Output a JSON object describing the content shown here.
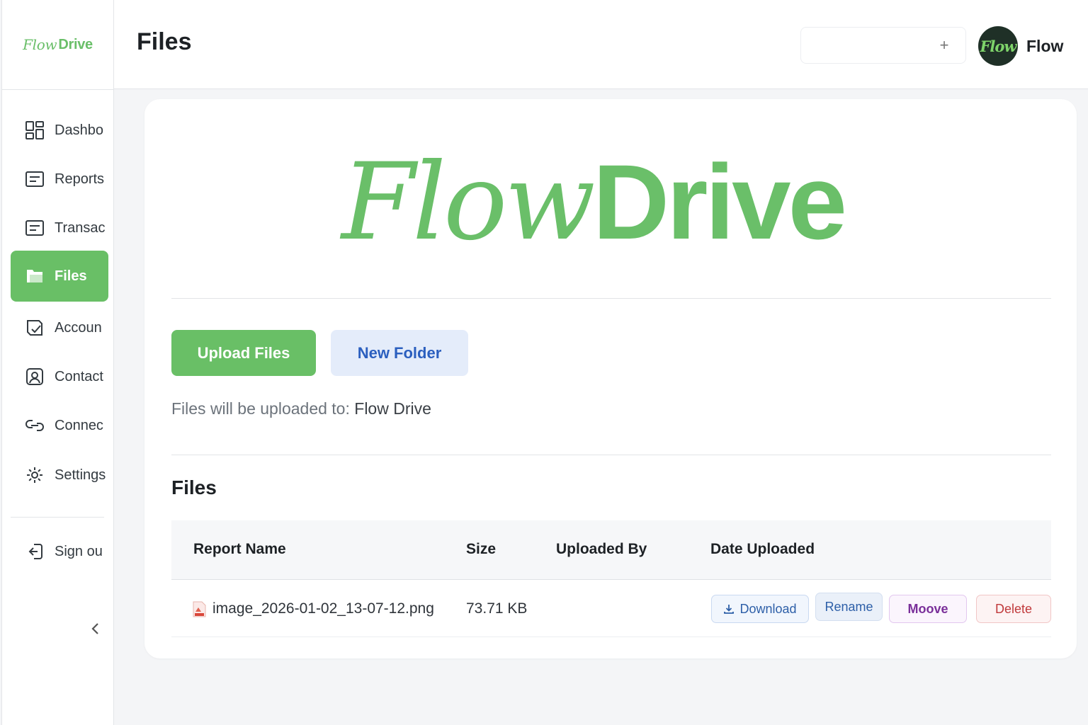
{
  "app": {
    "logo_flow": "Flow",
    "logo_drive": "Drive",
    "brand_color": "#6abf69"
  },
  "sidebar": {
    "items": [
      {
        "label": "Dashbo",
        "icon": "dashboard-icon",
        "active": false
      },
      {
        "label": "Reports",
        "icon": "reports-icon",
        "active": false
      },
      {
        "label": "Transac",
        "icon": "transactions-icon",
        "active": false
      },
      {
        "label": "Files",
        "icon": "folder-icon",
        "active": true
      },
      {
        "label": "Accoun",
        "icon": "accounts-icon",
        "active": false
      },
      {
        "label": "Contact",
        "icon": "contact-icon",
        "active": false
      },
      {
        "label": "Connec",
        "icon": "connections-icon",
        "active": false
      },
      {
        "label": "Settings",
        "icon": "gear-icon",
        "active": false
      },
      {
        "label": "Sign ou",
        "icon": "sign-out-icon",
        "active": false
      }
    ],
    "collapse_icon": "chevron-left-icon"
  },
  "header": {
    "title": "Files",
    "add_icon": "plus-icon",
    "avatar_text": "Flow",
    "user_name": "Flow"
  },
  "main": {
    "brand_flow": "Flow",
    "brand_drive": "Drive",
    "upload_button": "Upload Files",
    "new_folder_button": "New Folder",
    "upload_dest_label": "Files will be uploaded to: ",
    "upload_dest_value": "Flow Drive",
    "files_section_title": "Files",
    "table": {
      "columns": [
        "Report Name",
        "Size",
        "Uploaded By",
        "Date Uploaded"
      ],
      "rows": [
        {
          "name": "image_2026-01-02_13-07-12.png",
          "size": "73.71 KB",
          "uploaded_by": "",
          "date_uploaded": "",
          "actions": {
            "download": "Download",
            "rename": "Rename",
            "moove": "Moove",
            "delete": "Delete"
          }
        }
      ]
    }
  }
}
